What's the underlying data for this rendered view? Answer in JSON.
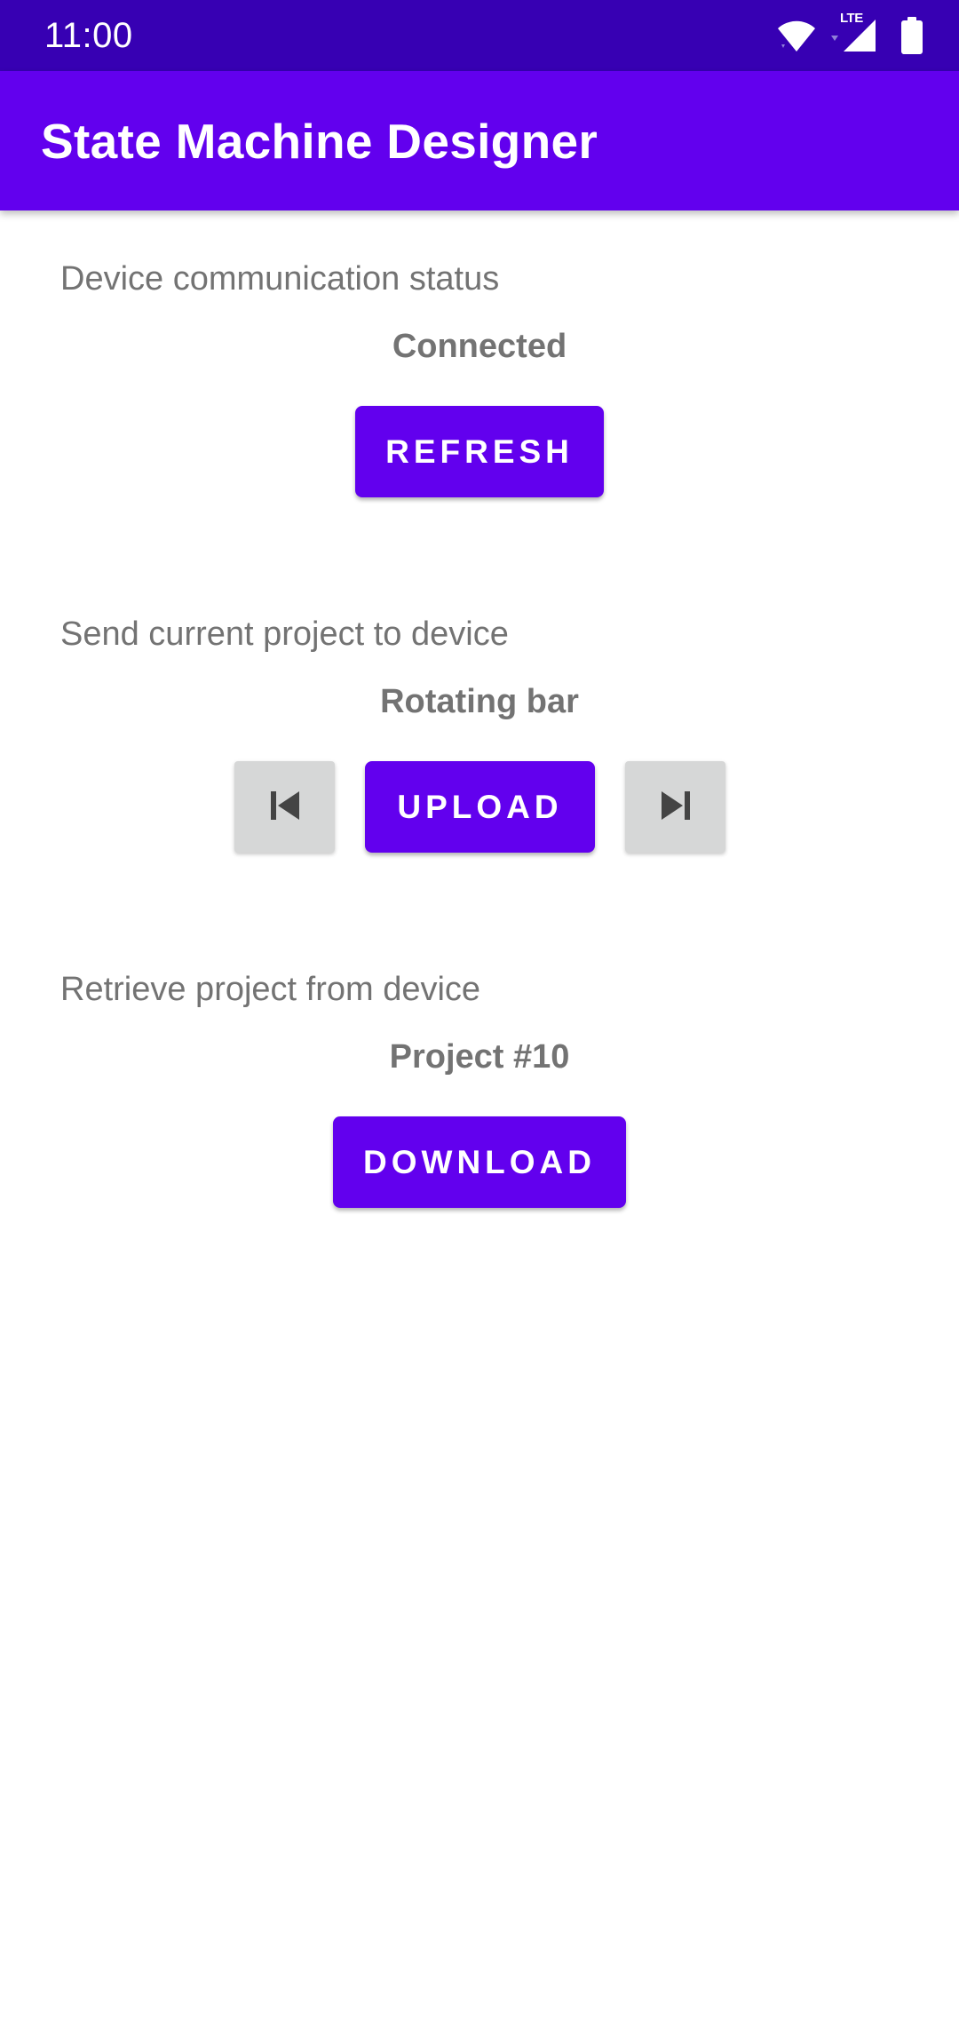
{
  "status_bar": {
    "time": "11:00",
    "network_label": "LTE",
    "icons": [
      "wifi-icon",
      "cell-signal-icon",
      "battery-icon"
    ]
  },
  "app_bar": {
    "title": "State Machine Designer",
    "color": "#6200EE"
  },
  "status_section": {
    "label": "Device communication status",
    "value": "Connected",
    "button_label": "REFRESH"
  },
  "upload_section": {
    "label": "Send current project to device",
    "value": "Rotating bar",
    "button_label": "UPLOAD",
    "prev_icon": "skip-previous-icon",
    "next_icon": "skip-next-icon"
  },
  "download_section": {
    "label": "Retrieve project from device",
    "value": "Project #10",
    "button_label": "DOWNLOAD"
  },
  "colors": {
    "status_bar": "#3700B3",
    "primary": "#6200EE",
    "secondary_button": "#D6D7D7",
    "text_muted": "#737373"
  }
}
